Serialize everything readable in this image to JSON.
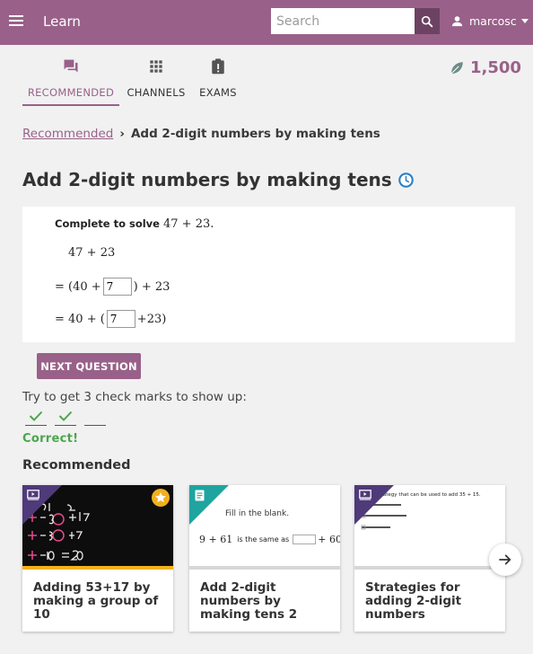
{
  "appbar": {
    "title": "Learn",
    "search_placeholder": "Search",
    "username": "marcosc"
  },
  "nav": {
    "tabs": [
      {
        "label": "RECOMMENDED",
        "icon": "forum-icon"
      },
      {
        "label": "CHANNELS",
        "icon": "apps-grid-icon"
      },
      {
        "label": "EXAMS",
        "icon": "clipboard-exam-icon"
      }
    ],
    "points": "1,500"
  },
  "breadcrumb": {
    "parent": "Recommended",
    "separator": "›",
    "current": "Add 2-digit numbers by making tens"
  },
  "page": {
    "title": "Add 2-digit numbers by making tens"
  },
  "exercise": {
    "prompt": "Complete to solve",
    "prompt_expr": "47 + 23.",
    "line1": "47 + 23",
    "line2_pre": "= (40 +",
    "line2_post": ") + 23",
    "line3_pre": "= 40 + (",
    "line3_post": "+23)",
    "answer1": "7",
    "answer2": "7"
  },
  "next_button": "NEXT QUESTION",
  "progress": {
    "instruction": "Try to get 3 check marks to show up:",
    "checks_done": 2,
    "checks_total": 3,
    "status": "Correct!"
  },
  "recommended": {
    "heading": "Recommended",
    "cards": [
      {
        "title": "Adding 53+17 by making a group of 10",
        "kind": "video",
        "bar_color": "#f2b01e"
      },
      {
        "title": "Add 2-digit numbers by making tens 2",
        "kind": "exercise",
        "thumb_text": "Fill in the blank.",
        "thumb_expr": "9 + 61",
        "thumb_mid": "is the same as",
        "thumb_end": "+ 60",
        "bar_color": "#d7d7d7"
      },
      {
        "title": "Strategies for adding 2-digit numbers",
        "kind": "video",
        "thumb_text": "Strategy that can be used to add 35 + 15.",
        "bar_color": "#d7d7d7"
      }
    ]
  },
  "colors": {
    "brand": "#996189",
    "correct": "#4aa64c",
    "accent_blue": "#2d80c4"
  }
}
